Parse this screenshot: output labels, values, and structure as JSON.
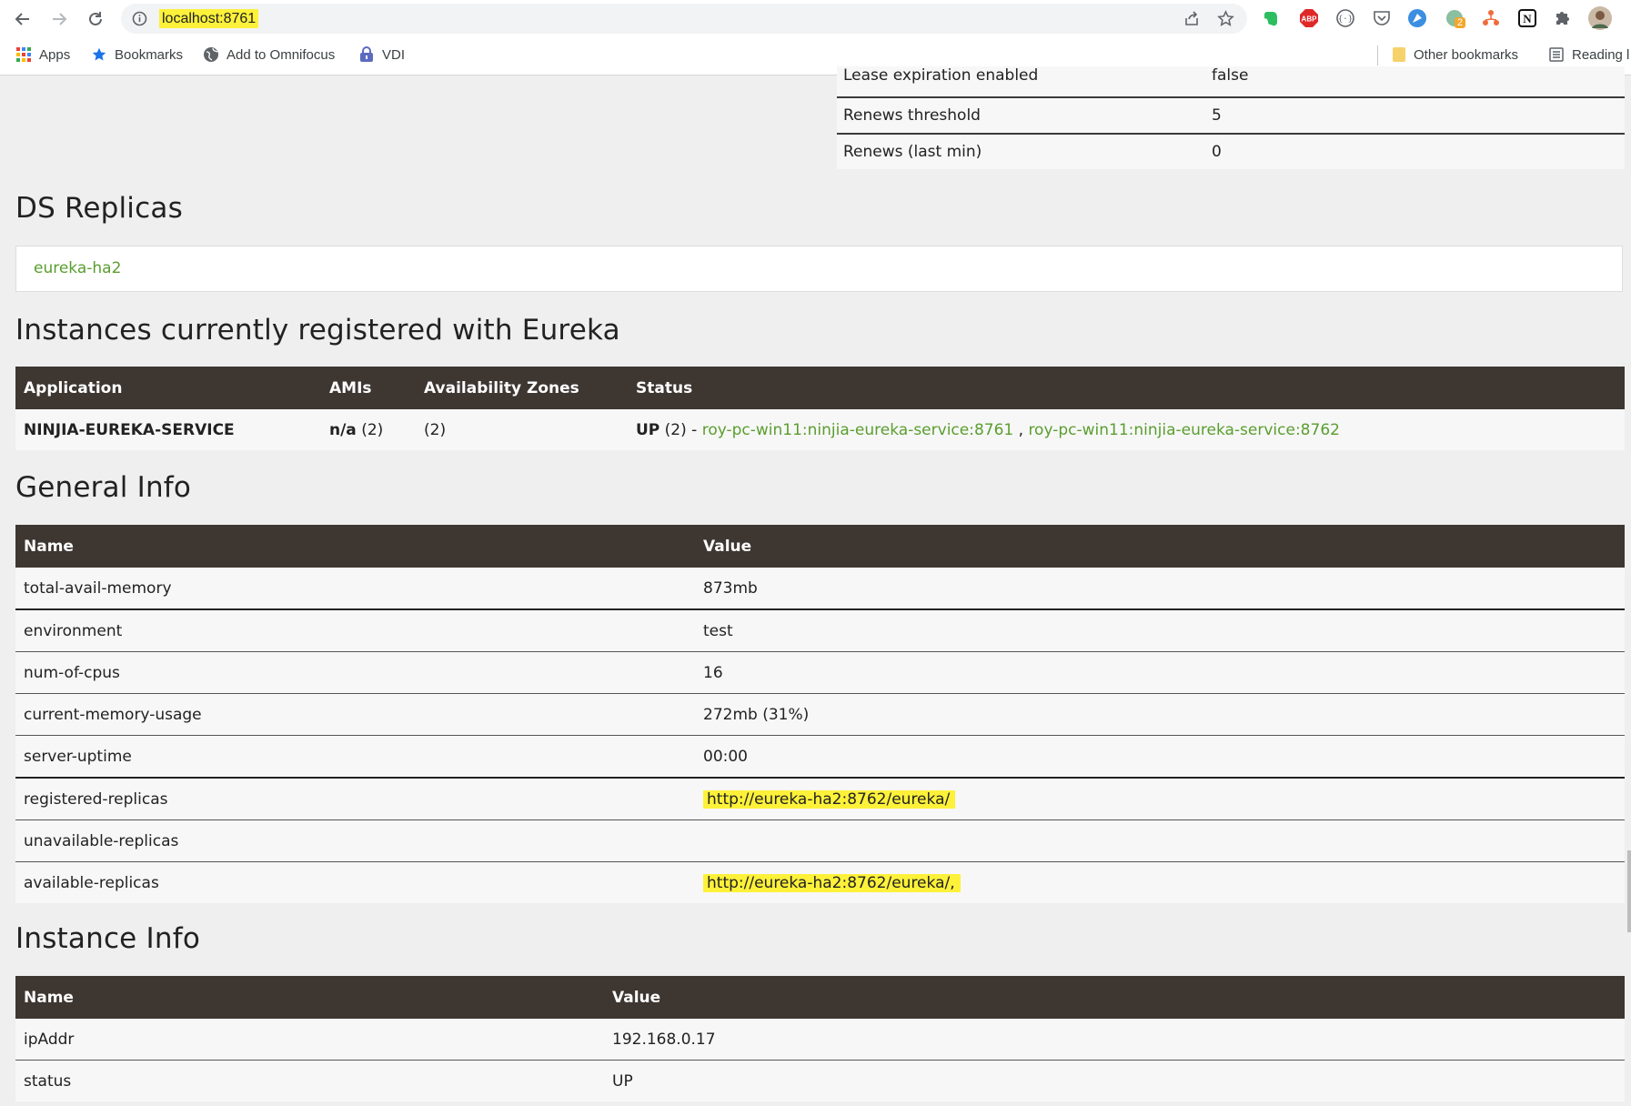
{
  "browser": {
    "url": "localhost:8761",
    "bookmarks": {
      "apps": "Apps",
      "bookmarks": "Bookmarks",
      "omnifocus": "Add to Omnifocus",
      "vdi": "VDI",
      "other": "Other bookmarks",
      "reading": "Reading l"
    },
    "extension_badge": "2"
  },
  "lease_stats": [
    {
      "name": "Lease expiration enabled",
      "value": "false"
    },
    {
      "name": "Renews threshold",
      "value": "5"
    },
    {
      "name": "Renews (last min)",
      "value": "0"
    }
  ],
  "ds_replicas": {
    "heading": "DS Replicas",
    "replica": "eureka-ha2"
  },
  "instances": {
    "heading": "Instances currently registered with Eureka",
    "headers": [
      "Application",
      "AMIs",
      "Availability Zones",
      "Status"
    ],
    "row": {
      "application": "NINJIA-EUREKA-SERVICE",
      "amis_bold": "n/a",
      "amis_count": " (2)",
      "zones": "(2)",
      "status_bold": "UP",
      "status_rest": " (2) - ",
      "instance1": "roy-pc-win11:ninjia-eureka-service:8761",
      "separator": " , ",
      "instance2": "roy-pc-win11:ninjia-eureka-service:8762"
    }
  },
  "general_info": {
    "heading": "General Info",
    "headers": [
      "Name",
      "Value"
    ],
    "rows": [
      {
        "name": "total-avail-memory",
        "value": "873mb"
      },
      {
        "name": "environment",
        "value": "test"
      },
      {
        "name": "num-of-cpus",
        "value": "16"
      },
      {
        "name": "current-memory-usage",
        "value": "272mb (31%)"
      },
      {
        "name": "server-uptime",
        "value": "00:00"
      },
      {
        "name": "registered-replicas",
        "value": "http://eureka-ha2:8762/eureka/"
      },
      {
        "name": "unavailable-replicas",
        "value": ""
      },
      {
        "name": "available-replicas",
        "value": "http://eureka-ha2:8762/eureka/,"
      }
    ]
  },
  "instance_info": {
    "heading": "Instance Info",
    "headers": [
      "Name",
      "Value"
    ],
    "rows": [
      {
        "name": "ipAddr",
        "value": "192.168.0.17"
      },
      {
        "name": "status",
        "value": "UP"
      }
    ]
  },
  "colors": {
    "header_bg": "#3d3631",
    "link": "#5a9e2f",
    "highlight": "#fdf13a",
    "page_bg": "#efefef"
  }
}
